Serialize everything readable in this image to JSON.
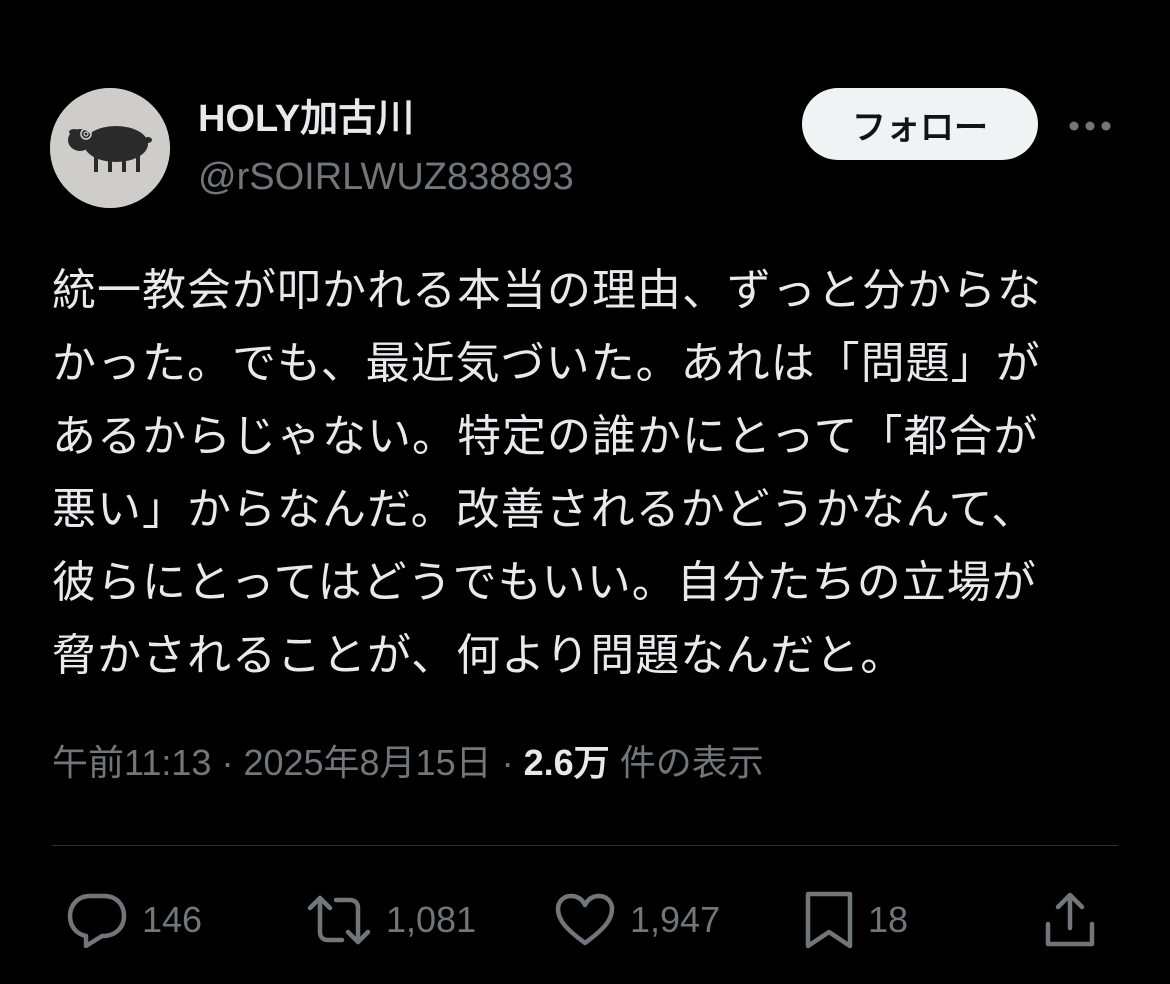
{
  "author": {
    "display_name": "HOLY加古川",
    "handle": "@rSOIRLWUZ838893"
  },
  "follow_label": "フォロー",
  "more_icon": "more-horizontal-icon",
  "tweet": {
    "text": "統一教会が叩かれる本当の理由、ずっと分からな\nかった。でも、最近気づいた。あれは「問題」が\nあるからじゃない。特定の誰かにとって「都合が\n悪い」からなんだ。改善されるかどうかなんて、\n彼らにとってはどうでもいい。自分たちの立場が\n脅かされることが、何より問題なんだと。"
  },
  "meta": {
    "time": "午前11:13",
    "separator1": "·",
    "date": "2025年8月15日",
    "separator2": "·",
    "views_count": "2.6万",
    "views_label": "件の表示"
  },
  "actions": {
    "reply": {
      "icon": "reply-icon",
      "count": "146"
    },
    "repost": {
      "icon": "repost-icon",
      "count": "1,081"
    },
    "like": {
      "icon": "heart-icon",
      "count": "1,947"
    },
    "bookmark": {
      "icon": "bookmark-icon",
      "count": "18"
    },
    "share": {
      "icon": "share-icon"
    }
  },
  "colors": {
    "background": "#000000",
    "primary_text": "#e7e9ea",
    "secondary_text": "#71767b",
    "follow_bg": "#eff3f4",
    "divider": "#2f3336"
  }
}
